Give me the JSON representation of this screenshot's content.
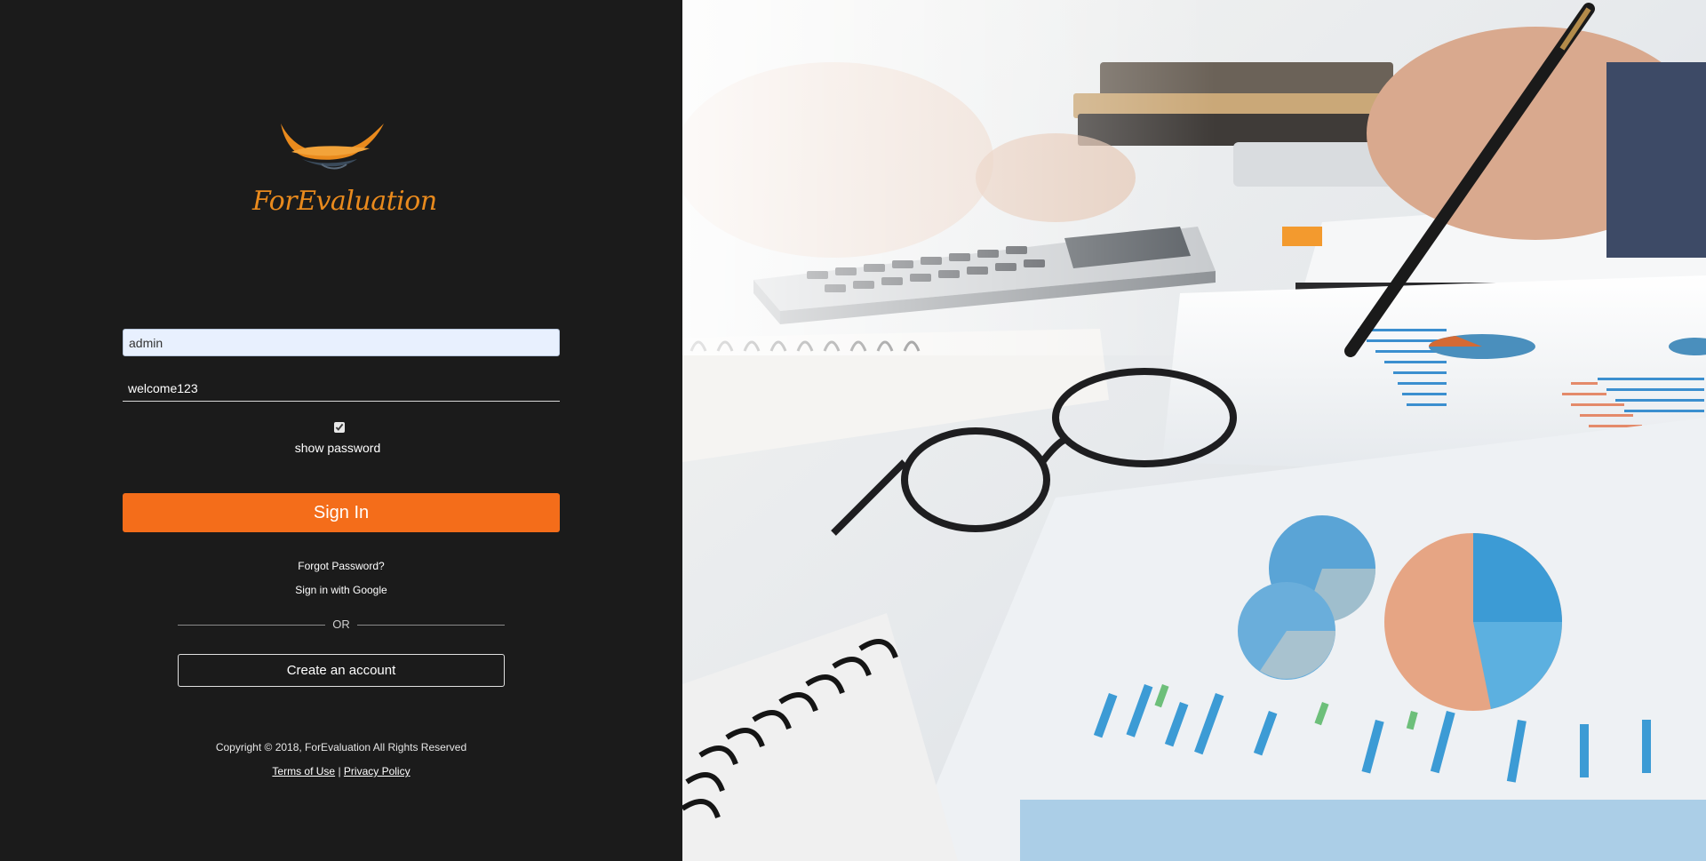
{
  "brand": {
    "name": "ForEvaluation",
    "accent_color": "#f46d1a",
    "logo_color": "#e98a1d"
  },
  "login": {
    "username_value": "admin",
    "password_value": "welcome123",
    "show_password_checked": true,
    "show_password_label": "show password",
    "signin_label": "Sign In",
    "forgot_label": "Forgot Password?",
    "google_label": "Sign in with Google",
    "or_label": "OR",
    "create_label": "Create an account"
  },
  "footer": {
    "copyright": "Copyright © 2018, ForEvaluation All Rights Reserved",
    "terms_label": "Terms of Use",
    "separator": "|",
    "privacy_label": "Privacy Policy"
  },
  "hero": {
    "icon": "finance-desk-photo-icon"
  }
}
